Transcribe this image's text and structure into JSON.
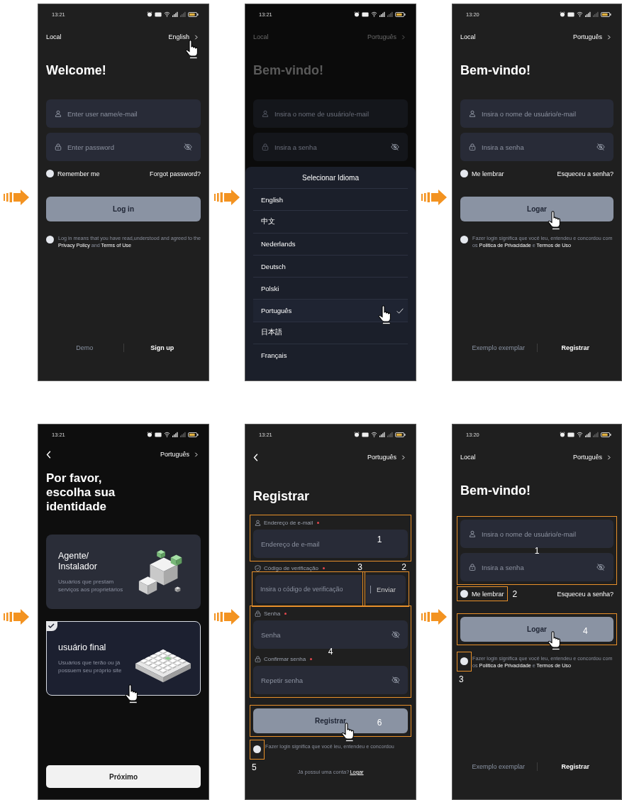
{
  "screens": [
    {
      "kind": "login",
      "time": "13:21",
      "nav": {
        "kind": "text",
        "label": "Local"
      },
      "language": {
        "label": "English",
        "tapped": true
      },
      "title": "Welcome!",
      "credentials": {
        "fields": [
          {
            "kind": "username",
            "placeholder": "Enter user name/e-mail"
          },
          {
            "kind": "password",
            "placeholder": "Enter password"
          }
        ]
      },
      "remember": {
        "label": "Remember me",
        "checked": false
      },
      "forgot": "Forgot password?",
      "button": {
        "label": "Log in"
      },
      "agreement": {
        "checked": false,
        "parts": [
          {
            "kind": "text",
            "text": "Log in means that you have read,understood and agreed to the "
          },
          {
            "kind": "link",
            "text": "Privacy Policy"
          },
          {
            "kind": "text",
            "text": " and "
          },
          {
            "kind": "link",
            "text": "Terms of Use"
          }
        ]
      },
      "footer": [
        {
          "label": "Demo"
        },
        {
          "label": "Sign up"
        }
      ]
    },
    {
      "kind": "login",
      "dimmed": true,
      "time": "13:21",
      "nav": {
        "kind": "text",
        "label": "Local"
      },
      "language": {
        "label": "Português"
      },
      "title": "Bem-vindo!",
      "credentials": {
        "fields": [
          {
            "kind": "username",
            "placeholder": "Insira o nome de usuário/e-mail"
          },
          {
            "kind": "password",
            "placeholder": "Insira a senha"
          }
        ]
      },
      "sheet": {
        "title": "Selecionar Idioma",
        "options": [
          {
            "label": "English",
            "selected": false
          },
          {
            "label": "中文",
            "selected": false
          },
          {
            "label": "Nederlands",
            "selected": false
          },
          {
            "label": "Deutsch",
            "selected": false
          },
          {
            "label": "Polski",
            "selected": false
          },
          {
            "label": "Português",
            "selected": true,
            "tapped": true
          },
          {
            "label": "日本語",
            "selected": false
          },
          {
            "label": "Français",
            "selected": false
          }
        ]
      }
    },
    {
      "kind": "login",
      "time": "13:20",
      "nav": {
        "kind": "text",
        "label": "Local"
      },
      "language": {
        "label": "Português"
      },
      "title": "Bem-vindo!",
      "credentials": {
        "fields": [
          {
            "kind": "username",
            "placeholder": "Insira o nome de usuário/e-mail"
          },
          {
            "kind": "password",
            "placeholder": "Insira a senha"
          }
        ]
      },
      "remember": {
        "label": "Me lembrar",
        "checked": false
      },
      "forgot": "Esqueceu a senha?",
      "button": {
        "label": "Logar",
        "tapped": true
      },
      "agreement": {
        "checked": false,
        "parts": [
          {
            "kind": "text",
            "text": "Fazer login significa que você leu, entendeu e concordou com os "
          },
          {
            "kind": "link",
            "text": "Política de Privacidade"
          },
          {
            "kind": "text",
            "text": " e "
          },
          {
            "kind": "link",
            "text": "Termos de Uso"
          }
        ]
      },
      "footer": [
        {
          "label": "Exemplo exemplar"
        },
        {
          "label": "Registrar"
        }
      ]
    },
    {
      "kind": "identity",
      "time": "13:21",
      "nav": {
        "kind": "back"
      },
      "language": {
        "label": "Português"
      },
      "title": "Por favor, escolha sua identidade",
      "options": [
        {
          "kind": "agent",
          "title": "Agente/\nInstalador",
          "description": "Usuários que prestam serviços aos proprietários",
          "selected": false
        },
        {
          "kind": "end_user",
          "title": "usuário final",
          "description": "Usuários que terão ou já possuem seu próprio site",
          "selected": true,
          "tapped": true
        }
      ],
      "button": {
        "label": "Próximo"
      }
    },
    {
      "kind": "register",
      "time": "13:21",
      "nav": {
        "kind": "back"
      },
      "language": {
        "label": "Português"
      },
      "title": "Registrar",
      "groups": [
        {
          "callout": {
            "label": "1"
          },
          "fields": [
            {
              "kind": "email",
              "label": "Endereço de e-mail",
              "required": true,
              "placeholder": "Endereço de e-mail"
            }
          ]
        },
        {
          "fields": [
            {
              "kind": "code",
              "label": "Código de verificação",
              "required": true,
              "placeholder": "Insira o código de verificação",
              "input_callout": {
                "label": "3"
              },
              "action": {
                "label": "Enviar",
                "callout": {
                  "label": "2"
                }
              }
            }
          ]
        },
        {
          "callout": {
            "label": "4"
          },
          "fields": [
            {
              "kind": "password",
              "label": "Senha",
              "required": true,
              "placeholder": "Senha"
            },
            {
              "kind": "password",
              "label": "Confirmar senha",
              "required": true,
              "placeholder": "Repetir senha"
            }
          ]
        }
      ],
      "button": {
        "label": "Registrar",
        "tapped": true,
        "callout": {
          "label": "6"
        }
      },
      "agreement": {
        "checked": false,
        "callout": {
          "label": "5"
        },
        "parts": [
          {
            "kind": "text",
            "text": "Fazer login significa que você leu, entendeu e concordou"
          }
        ]
      },
      "signin": {
        "prompt": "Já possui uma conta?",
        "link": "Logar"
      }
    },
    {
      "kind": "login",
      "time": "13:20",
      "nav": {
        "kind": "text",
        "label": "Local"
      },
      "language": {
        "label": "Português"
      },
      "title": "Bem-vindo!",
      "credentials": {
        "callout": {
          "label": "1"
        },
        "fields": [
          {
            "kind": "username",
            "placeholder": "Insira o nome de usuário/e-mail"
          },
          {
            "kind": "password",
            "placeholder": "Insira a senha"
          }
        ]
      },
      "remember": {
        "label": "Me lembrar",
        "checked": false,
        "callout": {
          "label": "2"
        }
      },
      "forgot": "Esqueceu a senha?",
      "button": {
        "label": "Logar",
        "tapped": true,
        "callout": {
          "label": "4"
        }
      },
      "agreement": {
        "checked": false,
        "callout": {
          "label": "3"
        },
        "parts": [
          {
            "kind": "text",
            "text": "Fazer login significa que você leu, entendeu e concordou com os "
          },
          {
            "kind": "link",
            "text": "Política de Privacidade"
          },
          {
            "kind": "text",
            "text": " e "
          },
          {
            "kind": "link",
            "text": "Termos de Uso"
          }
        ]
      },
      "footer": [
        {
          "label": "Exemplo exemplar"
        },
        {
          "label": "Registrar"
        }
      ]
    }
  ]
}
